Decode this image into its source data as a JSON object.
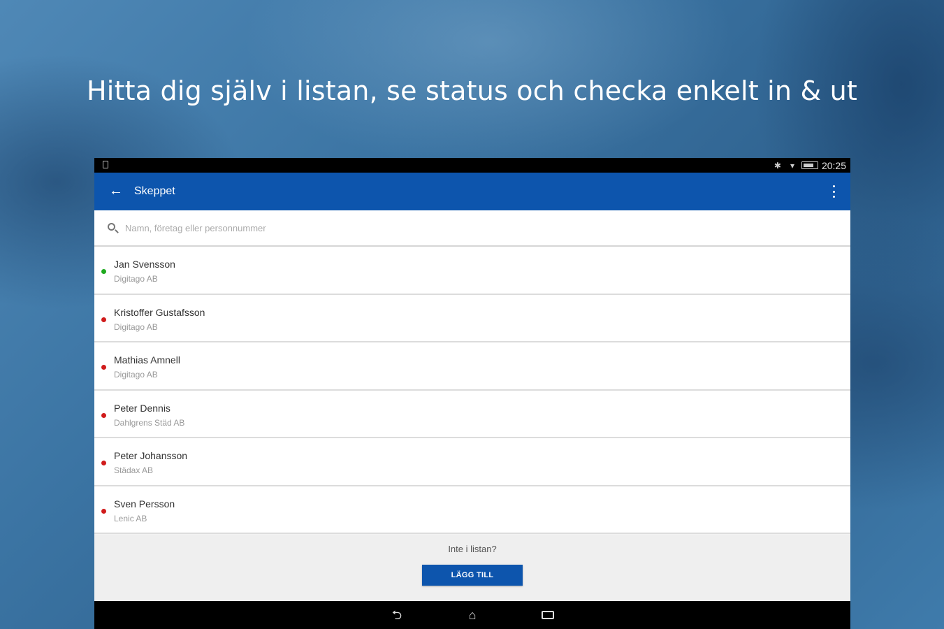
{
  "headline": "Hitta dig själv i listan, se status och checka enkelt in & ut",
  "status_bar": {
    "time": "20:25",
    "icons": [
      "bluetooth-icon",
      "wifi-icon",
      "battery-icon"
    ]
  },
  "app_bar": {
    "title": "Skeppet",
    "back_icon": "arrow-left-icon",
    "menu_icon": "more-vert-icon",
    "color": "#0d55ad"
  },
  "search": {
    "placeholder": "Namn, företag eller personnummer",
    "value": ""
  },
  "people": [
    {
      "name": "Jan Svensson",
      "company": "Digitago AB",
      "status": "in",
      "status_color": "#1faa1f"
    },
    {
      "name": "Kristoffer Gustafsson",
      "company": "Digitago AB",
      "status": "out",
      "status_color": "#d01b1b"
    },
    {
      "name": "Mathias Amnell",
      "company": "Digitago AB",
      "status": "out",
      "status_color": "#d01b1b"
    },
    {
      "name": "Peter Dennis",
      "company": "Dahlgrens Städ AB",
      "status": "out",
      "status_color": "#d01b1b"
    },
    {
      "name": "Peter Johansson",
      "company": "Städax AB",
      "status": "out",
      "status_color": "#d01b1b"
    },
    {
      "name": "Sven Persson",
      "company": "Lenic AB",
      "status": "out",
      "status_color": "#d01b1b"
    }
  ],
  "footer": {
    "prompt": "Inte i listan?",
    "add_label": "LÄGG TILL"
  },
  "nav_bar": {
    "icons": [
      "back-icon",
      "home-icon",
      "recent-apps-icon"
    ]
  }
}
